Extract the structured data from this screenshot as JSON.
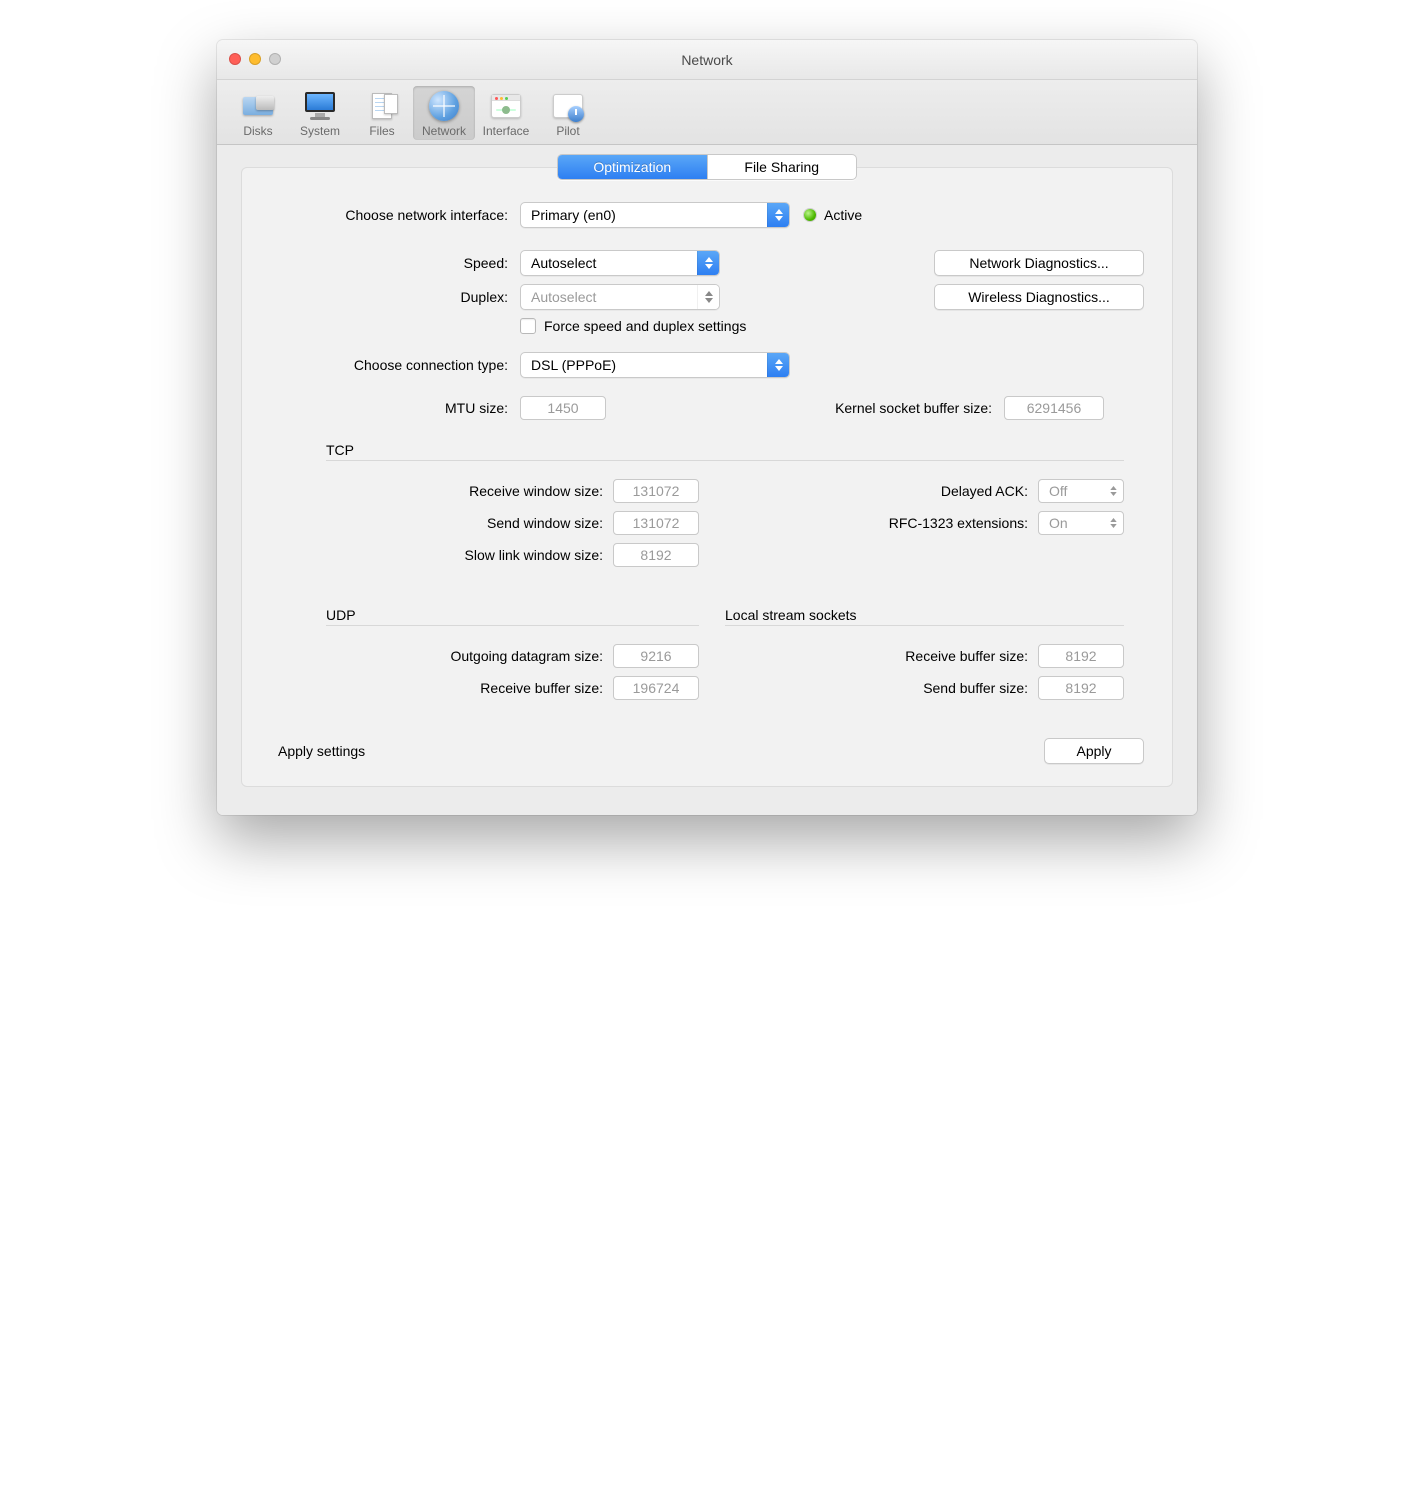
{
  "window": {
    "title": "Network"
  },
  "toolbar": {
    "items": [
      {
        "label": "Disks"
      },
      {
        "label": "System"
      },
      {
        "label": "Files"
      },
      {
        "label": "Network"
      },
      {
        "label": "Interface"
      },
      {
        "label": "Pilot"
      }
    ]
  },
  "tabs": {
    "optimization": "Optimization",
    "filesharing": "File Sharing"
  },
  "interface": {
    "label": "Choose network interface:",
    "value": "Primary (en0)",
    "status": "Active"
  },
  "speed": {
    "label": "Speed:",
    "value": "Autoselect"
  },
  "duplex": {
    "label": "Duplex:",
    "value": "Autoselect"
  },
  "buttons": {
    "net_diag": "Network Diagnostics...",
    "wifi_diag": "Wireless Diagnostics...",
    "apply": "Apply"
  },
  "force_checkbox": {
    "label": "Force speed and duplex settings"
  },
  "connection": {
    "label": "Choose connection type:",
    "value": "DSL (PPPoE)"
  },
  "mtu": {
    "label": "MTU size:",
    "value": "1450"
  },
  "kbuf": {
    "label": "Kernel socket buffer size:",
    "value": "6291456"
  },
  "sections": {
    "tcp": "TCP",
    "udp": "UDP",
    "local": "Local stream sockets"
  },
  "tcp": {
    "recv_win": {
      "label": "Receive window size:",
      "value": "131072"
    },
    "send_win": {
      "label": "Send window size:",
      "value": "131072"
    },
    "slow_link": {
      "label": "Slow link window size:",
      "value": "8192"
    },
    "delayed_ack": {
      "label": "Delayed ACK:",
      "value": "Off"
    },
    "rfc1323": {
      "label": "RFC-1323 extensions:",
      "value": "On"
    }
  },
  "udp": {
    "out_dg": {
      "label": "Outgoing datagram size:",
      "value": "9216"
    },
    "recv_buf": {
      "label": "Receive buffer size:",
      "value": "196724"
    }
  },
  "local": {
    "recv_buf": {
      "label": "Receive buffer size:",
      "value": "8192"
    },
    "send_buf": {
      "label": "Send buffer size:",
      "value": "8192"
    }
  },
  "footer": {
    "label": "Apply settings"
  }
}
